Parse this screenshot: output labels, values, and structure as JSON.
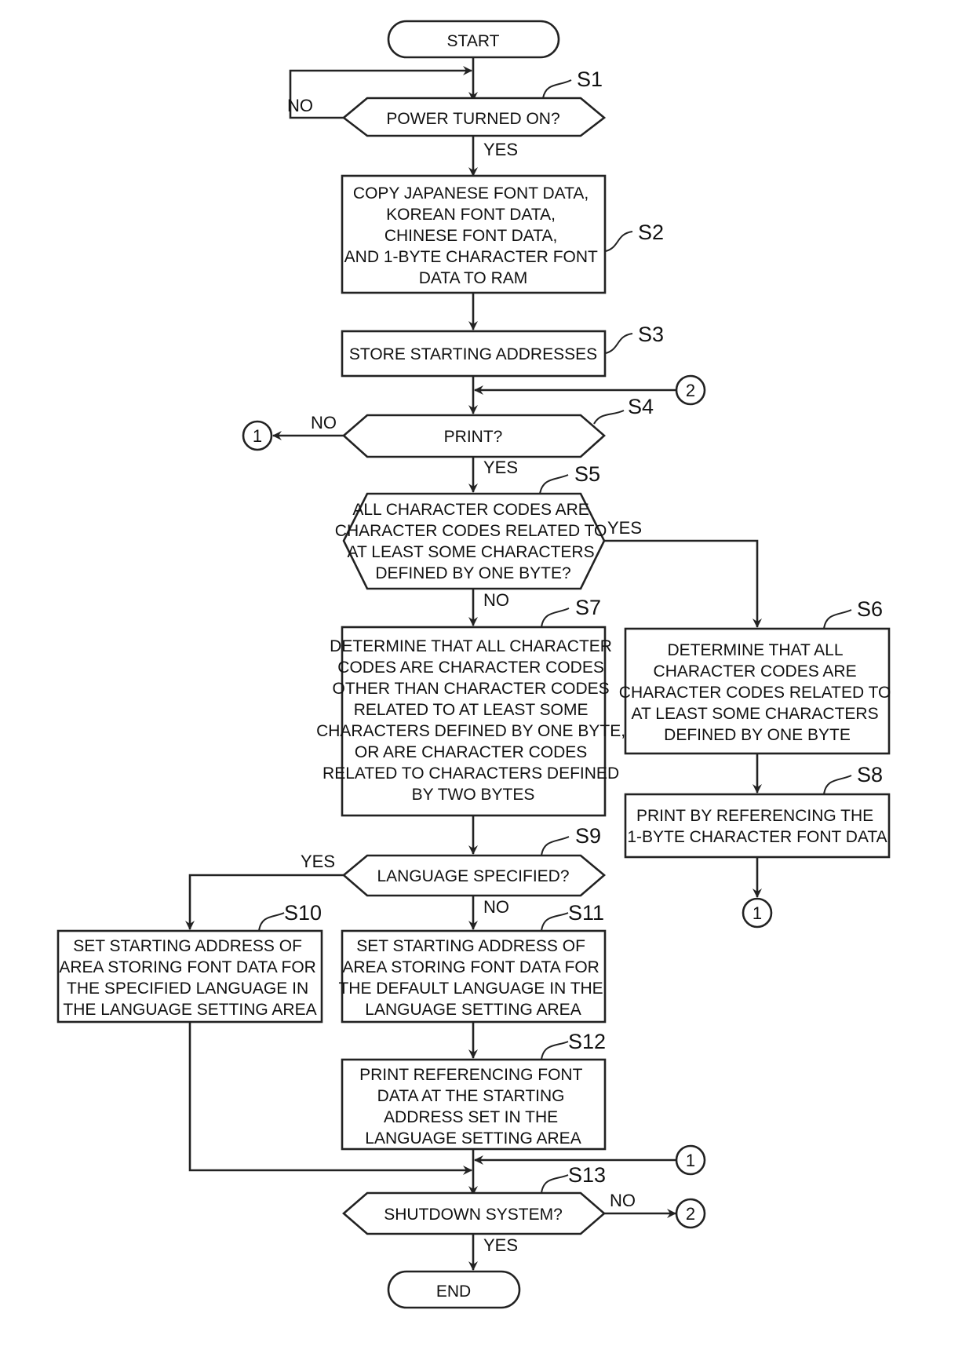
{
  "flowchart": {
    "terminals": {
      "start": "START",
      "end": "END"
    },
    "steps": {
      "S1": {
        "id": "S1",
        "type": "decision",
        "lines": [
          "POWER TURNED ON?"
        ]
      },
      "S2": {
        "id": "S2",
        "type": "process",
        "lines": [
          "COPY JAPANESE FONT DATA,",
          "KOREAN FONT DATA,",
          "CHINESE FONT DATA,",
          "AND 1-BYTE CHARACTER FONT",
          "DATA TO RAM"
        ]
      },
      "S3": {
        "id": "S3",
        "type": "process",
        "lines": [
          "STORE STARTING ADDRESSES"
        ]
      },
      "S4": {
        "id": "S4",
        "type": "decision",
        "lines": [
          "PRINT?"
        ]
      },
      "S5": {
        "id": "S5",
        "type": "decision",
        "lines": [
          "ALL CHARACTER CODES ARE",
          "CHARACTER CODES RELATED TO",
          "AT LEAST SOME CHARACTERS",
          "DEFINED BY ONE BYTE?"
        ]
      },
      "S6": {
        "id": "S6",
        "type": "process",
        "lines": [
          "DETERMINE THAT ALL",
          "CHARACTER CODES ARE",
          "CHARACTER CODES RELATED TO",
          "AT LEAST SOME CHARACTERS",
          "DEFINED BY ONE BYTE"
        ]
      },
      "S7": {
        "id": "S7",
        "type": "process",
        "lines": [
          "DETERMINE THAT ALL CHARACTER",
          "CODES ARE CHARACTER CODES",
          "OTHER THAN CHARACTER CODES",
          "RELATED TO AT LEAST SOME",
          "CHARACTERS DEFINED BY ONE BYTE,",
          "OR ARE CHARACTER CODES",
          "RELATED TO CHARACTERS DEFINED",
          "BY TWO BYTES"
        ]
      },
      "S8": {
        "id": "S8",
        "type": "process",
        "lines": [
          "PRINT BY REFERENCING THE",
          "1-BYTE CHARACTER FONT DATA"
        ]
      },
      "S9": {
        "id": "S9",
        "type": "decision",
        "lines": [
          "LANGUAGE SPECIFIED?"
        ]
      },
      "S10": {
        "id": "S10",
        "type": "process",
        "lines": [
          "SET STARTING ADDRESS OF",
          "AREA STORING FONT DATA FOR",
          "THE SPECIFIED LANGUAGE IN",
          "THE LANGUAGE SETTING AREA"
        ]
      },
      "S11": {
        "id": "S11",
        "type": "process",
        "lines": [
          "SET STARTING ADDRESS OF",
          "AREA STORING FONT DATA FOR",
          "THE DEFAULT LANGUAGE IN THE",
          "LANGUAGE SETTING AREA"
        ]
      },
      "S12": {
        "id": "S12",
        "type": "process",
        "lines": [
          "PRINT REFERENCING FONT",
          "DATA AT THE STARTING",
          "ADDRESS SET IN THE",
          "LANGUAGE SETTING AREA"
        ]
      },
      "S13": {
        "id": "S13",
        "type": "decision",
        "lines": [
          "SHUTDOWN SYSTEM?"
        ]
      }
    },
    "branch_labels": {
      "yes": "YES",
      "no": "NO"
    },
    "connectors": {
      "c1": "1",
      "c2": "2"
    },
    "edges": [
      {
        "from": "START",
        "to": "S1"
      },
      {
        "from": "S1",
        "to": "S1",
        "label": "NO"
      },
      {
        "from": "S1",
        "to": "S2",
        "label": "YES"
      },
      {
        "from": "S2",
        "to": "S3"
      },
      {
        "from": "S3",
        "to": "S4"
      },
      {
        "from": "connector-2",
        "to": "S4"
      },
      {
        "from": "S4",
        "to": "connector-1",
        "label": "NO"
      },
      {
        "from": "S4",
        "to": "S5",
        "label": "YES"
      },
      {
        "from": "S5",
        "to": "S6",
        "label": "YES"
      },
      {
        "from": "S5",
        "to": "S7",
        "label": "NO"
      },
      {
        "from": "S6",
        "to": "S8"
      },
      {
        "from": "S8",
        "to": "connector-1"
      },
      {
        "from": "S7",
        "to": "S9"
      },
      {
        "from": "S9",
        "to": "S10",
        "label": "YES"
      },
      {
        "from": "S9",
        "to": "S11",
        "label": "NO"
      },
      {
        "from": "S11",
        "to": "S12"
      },
      {
        "from": "S10",
        "to": "S13"
      },
      {
        "from": "S12",
        "to": "S13"
      },
      {
        "from": "connector-1",
        "to": "S13"
      },
      {
        "from": "S13",
        "to": "connector-2",
        "label": "NO"
      },
      {
        "from": "S13",
        "to": "END",
        "label": "YES"
      }
    ]
  }
}
